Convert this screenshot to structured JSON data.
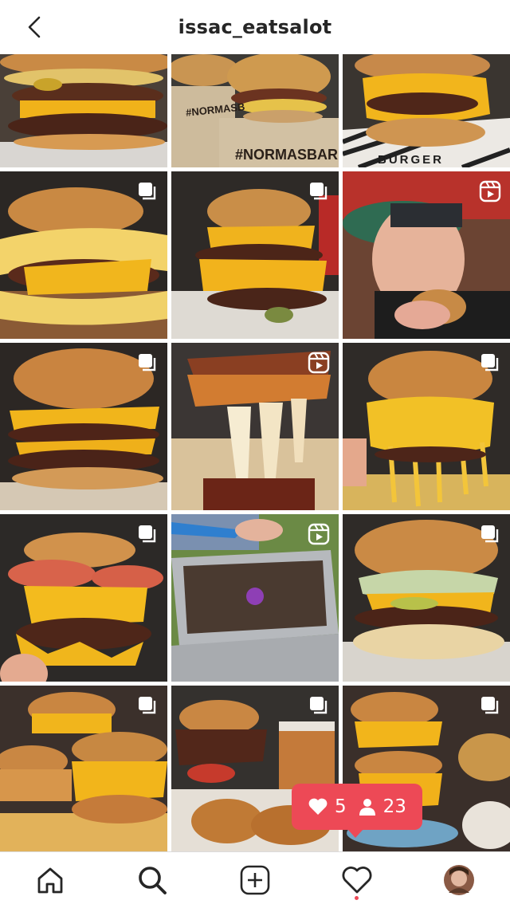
{
  "header": {
    "username": "issac_eatsalot"
  },
  "tiles": [
    {
      "stamps": []
    },
    {
      "stamps": [
        "#NORMASB",
        "#NORMASBAR"
      ]
    },
    {
      "stamps": [
        "BURGER"
      ]
    }
  ],
  "notification": {
    "likes": "5",
    "followers": "23"
  },
  "colors": {
    "accent": "#ed4956",
    "text": "#262626"
  },
  "icons": [
    "back-arrow-icon",
    "carousel-icon",
    "reels-icon",
    "heart-icon",
    "person-icon",
    "home-icon",
    "search-icon",
    "new-post-icon",
    "activity-heart-icon",
    "profile-avatar"
  ]
}
